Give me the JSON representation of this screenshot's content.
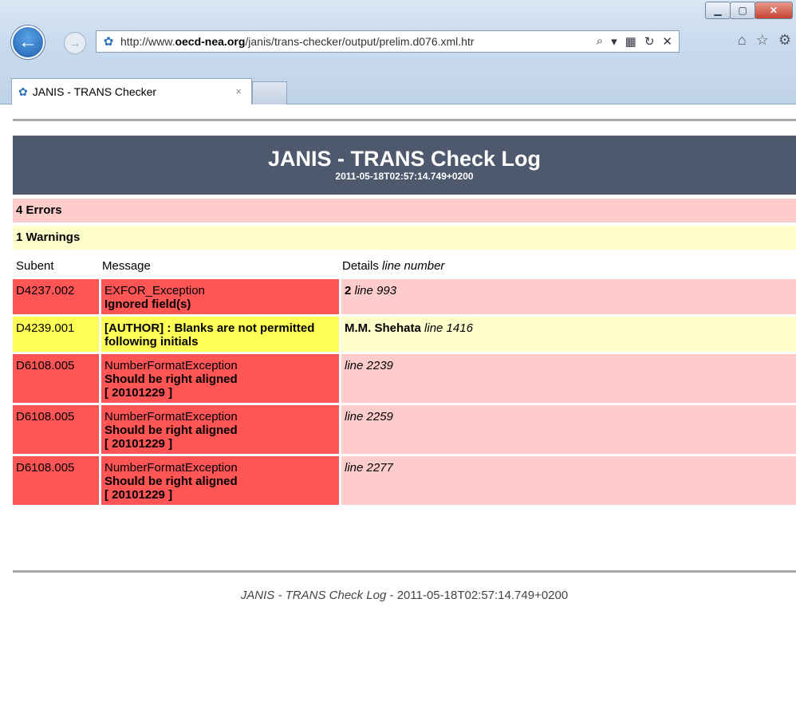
{
  "browser": {
    "url_prefix": "http://www.",
    "url_domain": "oecd-nea.org",
    "url_path": "/janis/trans-checker/output/prelim.d076.xml.htr",
    "tab_title": "JANIS - TRANS Checker",
    "close_label": "×"
  },
  "header": {
    "title": "JANIS - TRANS Check Log",
    "timestamp": "2011-05-18T02:57:14.749+0200"
  },
  "summary": {
    "errors": "4 Errors",
    "warnings": "1 Warnings"
  },
  "columns": {
    "subent": "Subent",
    "message": "Message",
    "details": "Details",
    "details_sub": "line number"
  },
  "rows": [
    {
      "subent": "D4237.002",
      "msg1": "EXFOR_Exception",
      "msg2": "Ignored field(s)",
      "msg3": "",
      "det_bold": "2",
      "det_line": "line 993",
      "level": "error"
    },
    {
      "subent": "D4239.001",
      "msg1": "",
      "msg2": "[AUTHOR] : Blanks are not permitted following initials",
      "msg3": "",
      "det_bold": "M.M. Shehata",
      "det_line": "line 1416",
      "level": "warning"
    },
    {
      "subent": "D6108.005",
      "msg1": "NumberFormatException",
      "msg2": "Should be right aligned",
      "msg3": "[ 20101229 ]",
      "det_bold": "",
      "det_line": "line 2239",
      "level": "error"
    },
    {
      "subent": "D6108.005",
      "msg1": "NumberFormatException",
      "msg2": "Should be right aligned",
      "msg3": "[ 20101229 ]",
      "det_bold": "",
      "det_line": "line 2259",
      "level": "error"
    },
    {
      "subent": "D6108.005",
      "msg1": "NumberFormatException",
      "msg2": "Should be right aligned",
      "msg3": "[ 20101229 ]",
      "det_bold": "",
      "det_line": "line 2277",
      "level": "error"
    }
  ],
  "footer": {
    "title": "JANIS - TRANS Check Log",
    "sep": " - ",
    "timestamp": "2011-05-18T02:57:14.749+0200"
  },
  "colors": {
    "banner": "#4e596d",
    "error_dark": "#ff5555",
    "error_light": "#ffcccc",
    "warning_dark": "#ffff55",
    "warning_light": "#ffffcc"
  }
}
